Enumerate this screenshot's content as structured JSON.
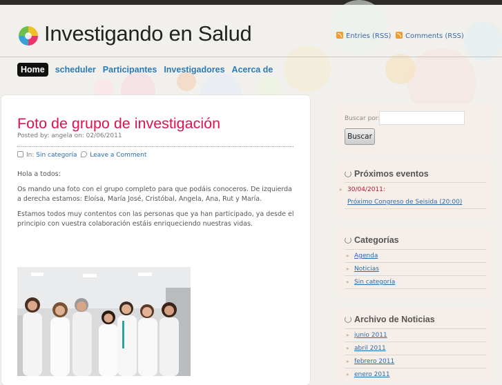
{
  "site": {
    "title": "Investigando en Salud",
    "feeds": {
      "entries": "Entries (RSS)",
      "comments": "Comments (RSS)"
    }
  },
  "nav": [
    "Home",
    "scheduler",
    "Participantes",
    "Investigadores",
    "Acerca de"
  ],
  "post": {
    "title": "Foto de grupo de investigación",
    "meta": "Posted by: angela on: 02/06/2011",
    "in_label": "In:",
    "category": "Sin categoría",
    "comment_link": "Leave a Comment",
    "paragraphs": [
      "Hola a todos:",
      "Os mando una foto con el grupo completo para que podáis conoceros. De izquierda a derecha estamos: Eloísa, María José, Cristóbal, Angela, Ana, Rut y María.",
      "Estamos todos muy contentos con las personas que ya han participado, ya desde el principio con vuestra colaboración estáis enriqueciendo nuestras vidas."
    ]
  },
  "sidebar": {
    "search": {
      "label": "Buscar por:",
      "button": "Buscar",
      "value": ""
    },
    "events": {
      "title": "Próximos eventos",
      "date": "30/04/2011:",
      "link": "Próximo Congreso de Seisida (20:00)"
    },
    "categories": {
      "title": "Categorías",
      "items": [
        "Agenda",
        "Noticias",
        "Sin categoría"
      ]
    },
    "archive": {
      "title": "Archivo de Noticias",
      "items": [
        "junio 2011",
        "abril 2011",
        "febrero 2011",
        "enero 2011"
      ]
    }
  },
  "colors": {
    "accent": "#e0124e",
    "link": "#2a7ab8",
    "nav_active_bg": "#111111"
  }
}
